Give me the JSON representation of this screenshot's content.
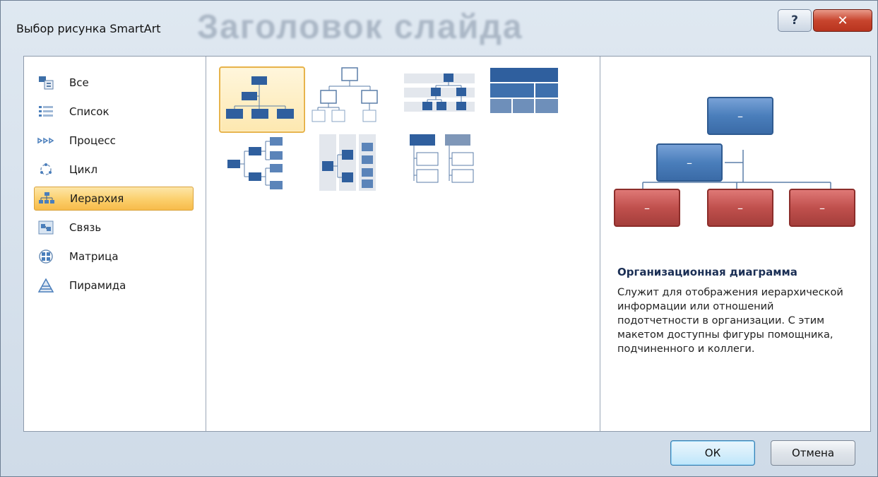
{
  "window": {
    "title": "Выбор рисунка SmartArt",
    "background_ghost_text": "Заголовок слайда",
    "help_glyph": "?",
    "close_glyph": "✕"
  },
  "categories": [
    {
      "label": "Все",
      "icon": "all-icon",
      "selected": false
    },
    {
      "label": "Список",
      "icon": "list-icon",
      "selected": false
    },
    {
      "label": "Процесс",
      "icon": "process-icon",
      "selected": false
    },
    {
      "label": "Цикл",
      "icon": "cycle-icon",
      "selected": false
    },
    {
      "label": "Иерархия",
      "icon": "hierarchy-icon",
      "selected": true
    },
    {
      "label": "Связь",
      "icon": "relationship-icon",
      "selected": false
    },
    {
      "label": "Матрица",
      "icon": "matrix-icon",
      "selected": false
    },
    {
      "label": "Пирамида",
      "icon": "pyramid-icon",
      "selected": false
    }
  ],
  "gallery": {
    "items": [
      {
        "name": "organization-chart",
        "selected": true
      },
      {
        "name": "hierarchy-outline",
        "selected": false
      },
      {
        "name": "labeled-hierarchy",
        "selected": false
      },
      {
        "name": "table-hierarchy",
        "selected": false
      },
      {
        "name": "horizontal-hierarchy",
        "selected": false
      },
      {
        "name": "horizontal-labeled-hierarchy",
        "selected": false
      },
      {
        "name": "hierarchy-list",
        "selected": false
      }
    ]
  },
  "preview": {
    "title": "Организационная диаграмма",
    "description": "Служит для отображения иерархической информации или отношений подотчетности в организации. С этим макетом доступны фигуры помощника, подчиненного и коллеги.",
    "box_glyph": "–"
  },
  "buttons": {
    "ok": "ОК",
    "cancel": "Отмена"
  },
  "colors": {
    "selection_orange": "#fbcf6b",
    "shape_blue": "#4a7ebb",
    "shape_red": "#c0504d"
  }
}
